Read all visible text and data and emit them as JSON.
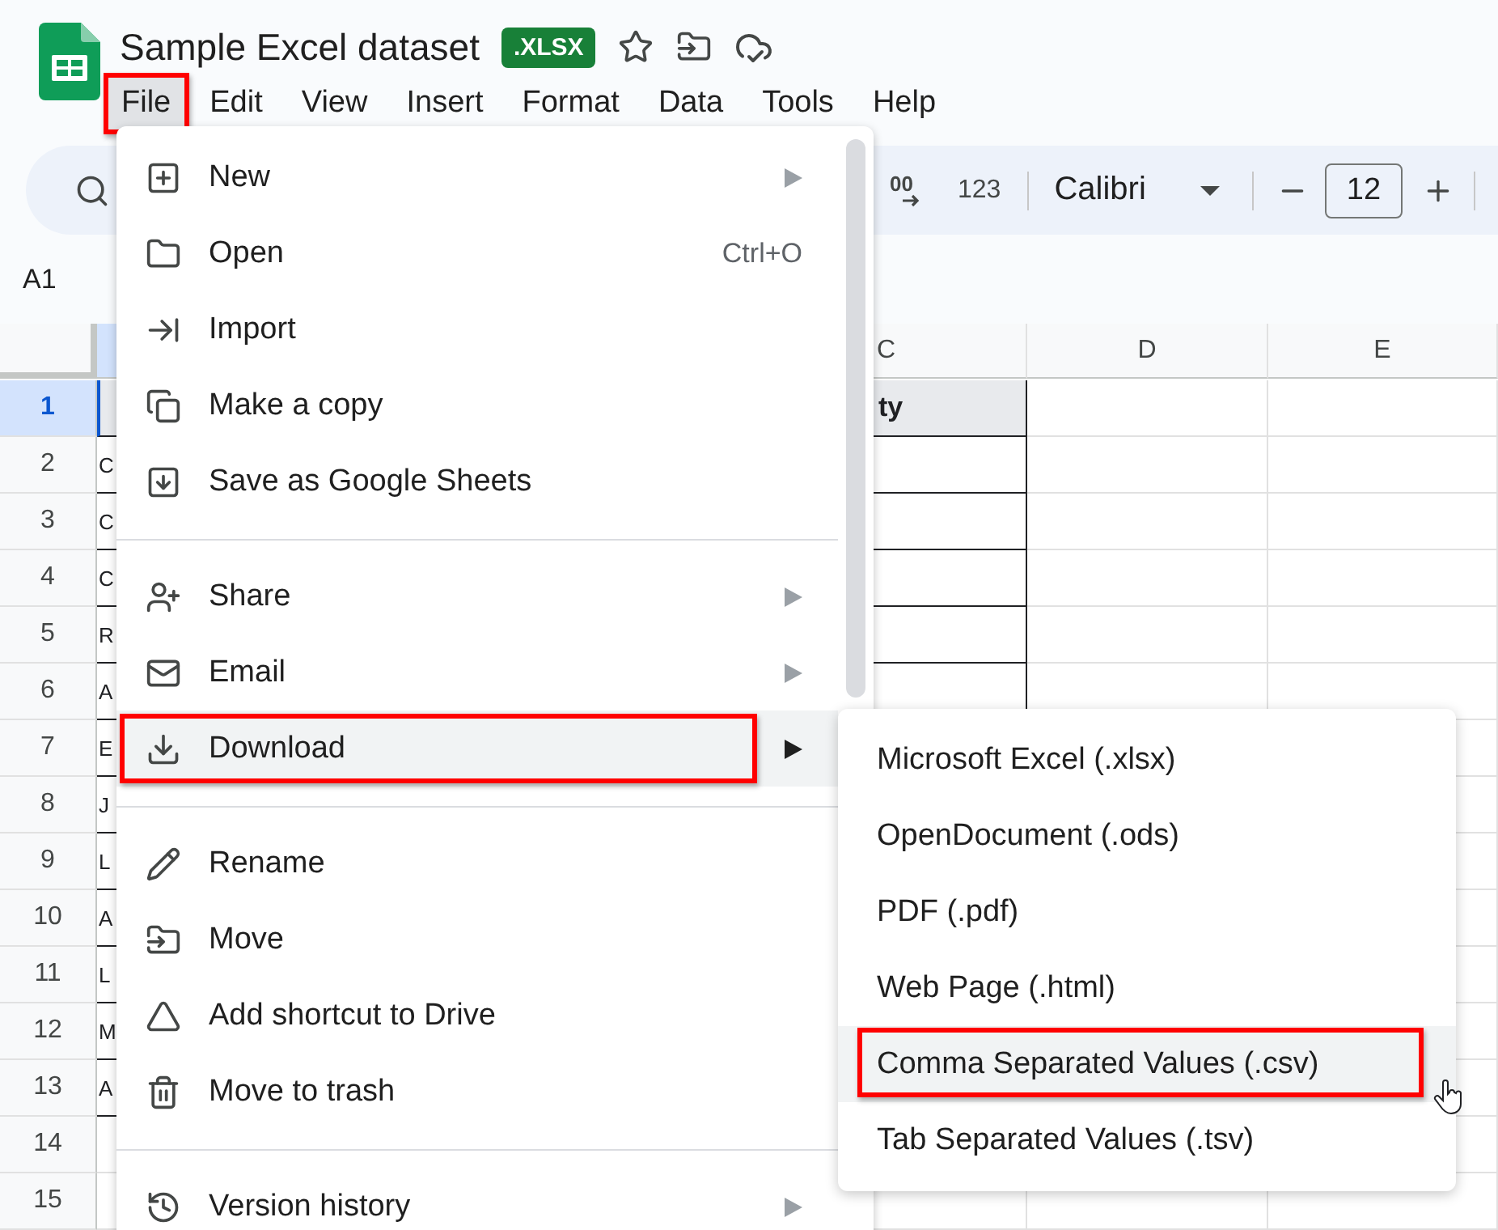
{
  "document": {
    "title": "Sample Excel dataset",
    "badge": ".XLSX"
  },
  "menu_bar": [
    {
      "label": "File",
      "selected": true,
      "highlighted": true
    },
    {
      "label": "Edit",
      "selected": false,
      "highlighted": false
    },
    {
      "label": "View",
      "selected": false,
      "highlighted": false
    },
    {
      "label": "Insert",
      "selected": false,
      "highlighted": false
    },
    {
      "label": "Format",
      "selected": false,
      "highlighted": false
    },
    {
      "label": "Data",
      "selected": false,
      "highlighted": false
    },
    {
      "label": "Tools",
      "selected": false,
      "highlighted": false
    },
    {
      "label": "Help",
      "selected": false,
      "highlighted": false
    }
  ],
  "toolbar": {
    "decimal_label": "00",
    "number_format": "123",
    "font": "Calibri",
    "font_size": "12"
  },
  "name_box": "A1",
  "sheet": {
    "columns": [
      {
        "label": "C"
      },
      {
        "label": "D"
      },
      {
        "label": "E"
      }
    ],
    "rows": [
      {
        "header": "1",
        "selected": true,
        "kind": "heading",
        "cell_c": "ty"
      },
      {
        "header": "2",
        "selected": false,
        "kind": "data",
        "cell_a": "C"
      },
      {
        "header": "3",
        "selected": false,
        "kind": "data",
        "cell_a": "C"
      },
      {
        "header": "4",
        "selected": false,
        "kind": "data",
        "cell_a": "C"
      },
      {
        "header": "5",
        "selected": false,
        "kind": "data",
        "cell_a": "R"
      },
      {
        "header": "6",
        "selected": false,
        "kind": "data",
        "cell_a": "A"
      },
      {
        "header": "7",
        "selected": false,
        "kind": "data",
        "cell_a": "E"
      },
      {
        "header": "8",
        "selected": false,
        "kind": "data",
        "cell_a": "J"
      },
      {
        "header": "9",
        "selected": false,
        "kind": "data",
        "cell_a": "L"
      },
      {
        "header": "10",
        "selected": false,
        "kind": "data",
        "cell_a": "A"
      },
      {
        "header": "11",
        "selected": false,
        "kind": "data",
        "cell_a": "L"
      },
      {
        "header": "12",
        "selected": false,
        "kind": "data",
        "cell_a": "M"
      },
      {
        "header": "13",
        "selected": false,
        "kind": "data",
        "cell_a": "A"
      },
      {
        "header": "14",
        "selected": false,
        "kind": "empty"
      },
      {
        "header": "15",
        "selected": false,
        "kind": "empty"
      }
    ]
  },
  "file_menu": [
    {
      "kind": "item",
      "label": "New",
      "has_submenu": true,
      "selected": false,
      "highlighted": false
    },
    {
      "kind": "item",
      "label": "Open",
      "shortcut": "Ctrl+O",
      "has_submenu": false,
      "selected": false,
      "highlighted": false
    },
    {
      "kind": "item",
      "label": "Import",
      "has_submenu": false,
      "selected": false,
      "highlighted": false
    },
    {
      "kind": "item",
      "label": "Make a copy",
      "has_submenu": false,
      "selected": false,
      "highlighted": false
    },
    {
      "kind": "item",
      "label": "Save as Google Sheets",
      "has_submenu": false,
      "selected": false,
      "highlighted": false
    },
    {
      "kind": "divider"
    },
    {
      "kind": "item",
      "label": "Share",
      "has_submenu": true,
      "selected": false,
      "highlighted": false
    },
    {
      "kind": "item",
      "label": "Email",
      "has_submenu": true,
      "selected": false,
      "highlighted": false
    },
    {
      "kind": "item",
      "label": "Download",
      "has_submenu": true,
      "selected": true,
      "highlighted": true
    },
    {
      "kind": "divider"
    },
    {
      "kind": "item",
      "label": "Rename",
      "has_submenu": false,
      "selected": false,
      "highlighted": false
    },
    {
      "kind": "item",
      "label": "Move",
      "has_submenu": false,
      "selected": false,
      "highlighted": false
    },
    {
      "kind": "item",
      "label": "Add shortcut to Drive",
      "has_submenu": false,
      "selected": false,
      "highlighted": false
    },
    {
      "kind": "item",
      "label": "Move to trash",
      "has_submenu": false,
      "selected": false,
      "highlighted": false
    },
    {
      "kind": "divider"
    },
    {
      "kind": "item",
      "label": "Version history",
      "has_submenu": true,
      "selected": false,
      "highlighted": false
    }
  ],
  "download_menu": [
    {
      "label": "Microsoft Excel (.xlsx)",
      "selected": false,
      "highlighted": false
    },
    {
      "label": "OpenDocument (.ods)",
      "selected": false,
      "highlighted": false
    },
    {
      "label": "PDF (.pdf)",
      "selected": false,
      "highlighted": false
    },
    {
      "label": "Web Page (.html)",
      "selected": false,
      "highlighted": false
    },
    {
      "label": "Comma Separated Values (.csv)",
      "selected": true,
      "highlighted": true
    },
    {
      "label": "Tab Separated Values (.tsv)",
      "selected": false,
      "highlighted": false
    }
  ]
}
